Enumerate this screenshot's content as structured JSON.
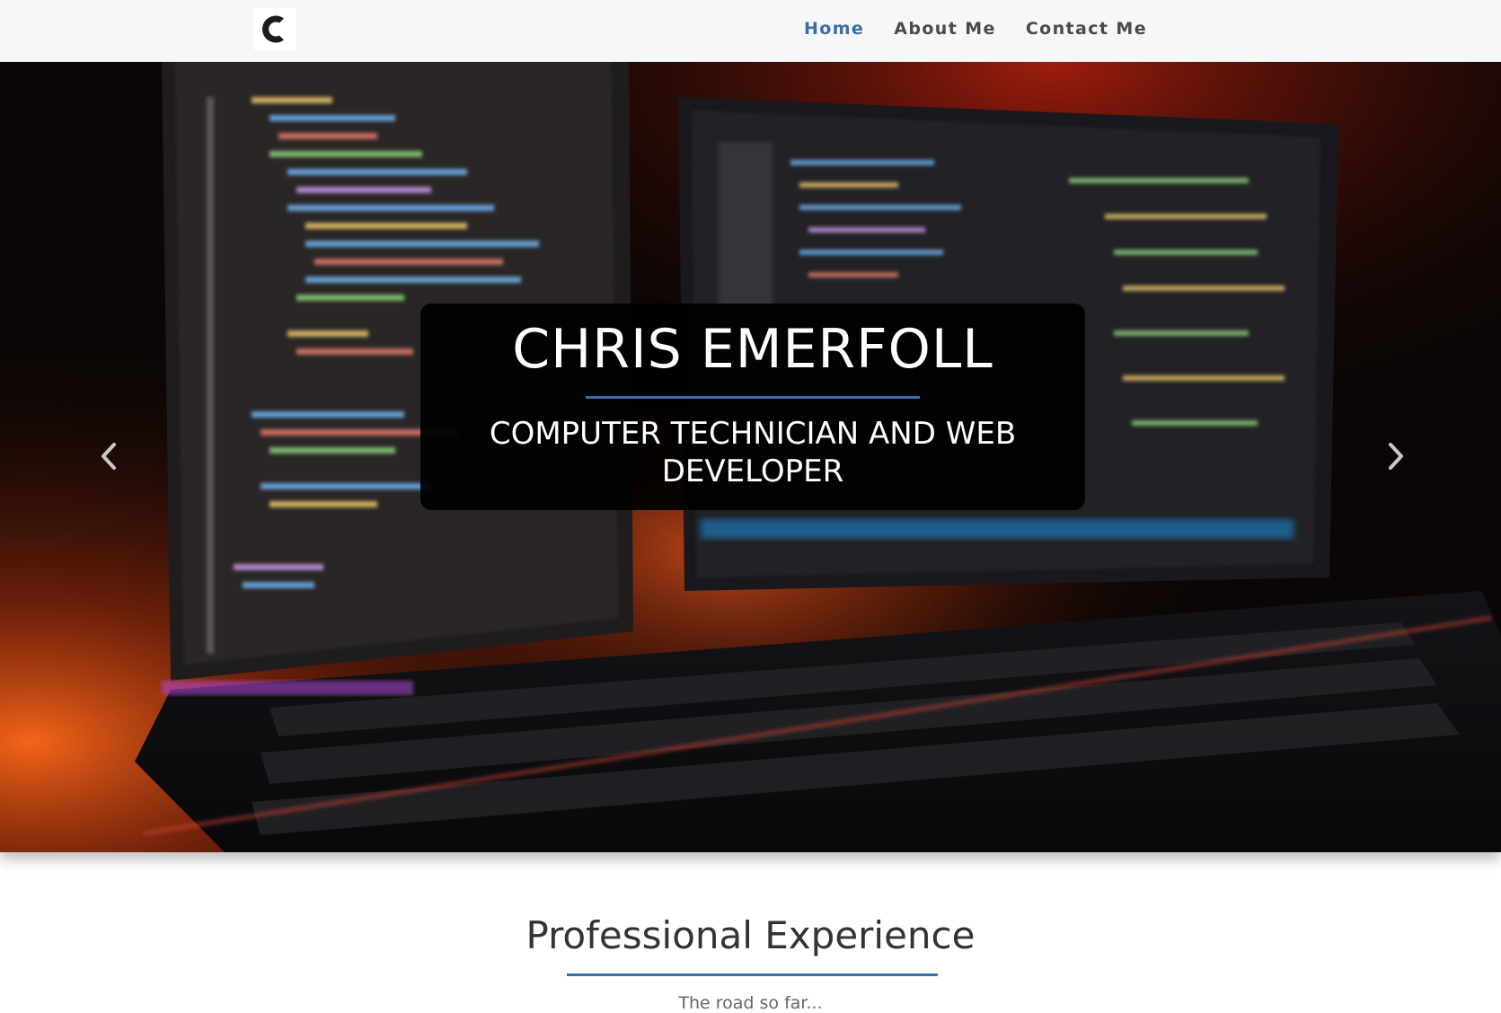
{
  "navbar": {
    "logo_icon": "c-letter-logo",
    "links": [
      {
        "label": "Home",
        "active": true
      },
      {
        "label": "About Me",
        "active": false
      },
      {
        "label": "Contact Me",
        "active": false
      }
    ]
  },
  "hero": {
    "background": "blurred-monitors-code-keyboard",
    "title": "CHRIS EMERFOLL",
    "subtitle": "COMPUTER TECHNICIAN AND WEB DEVELOPER",
    "prev_icon": "chevron-left-icon",
    "next_icon": "chevron-right-icon"
  },
  "section": {
    "title": "Professional Experience",
    "subtitle": "The road so far..."
  },
  "colors": {
    "accent": "#3a6ea8",
    "navbar_bg": "#f6f7f9",
    "nav_text": "#4a4a4a",
    "caption_bg": "#000000",
    "heading_text": "#333333"
  }
}
